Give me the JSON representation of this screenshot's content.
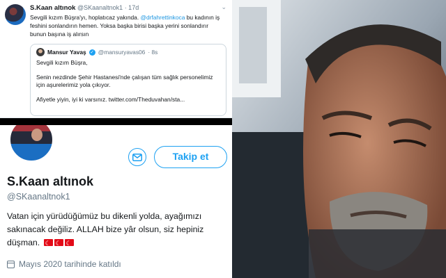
{
  "tweet": {
    "name": "S.Kaan altınok",
    "handle": "@SKaanaltnok1",
    "time": "· 17d",
    "text_part1": "Sevgili kızım Büşra'yı, hoplatıcaz yakında. ",
    "mention": "@drfahrettinkoca",
    "text_part2": " bu kadının iş feshini sonlandırın hemen. Yoksa başka birisi başka yerini sonlandırır bunun başına iş alırsın"
  },
  "quote": {
    "name": "Mansur Yavaş",
    "handle": "@mansuryavas06",
    "time": "· 8s",
    "line1": "Sevgili kızım Büşra,",
    "line2": "Senin nezdinde Şehir Hastanesi'nde çalışan tüm sağlık personelimiz için aşurelerimiz yola çıkıyor.",
    "line3": "Afiyetle yiyin, iyi ki varsınız. twitter.com/Theduvahan/sta..."
  },
  "profile": {
    "follow_label": "Takip et",
    "name": "S.Kaan altınok",
    "handle": "@SKaanaltnok1",
    "bio": "Vatan için yürüdüğümüz bu dikenli yolda, ayağımızı sakınacak değiliz. ALLAH bize yâr olsun, siz hepiniz düşman.",
    "joined": "Mayıs 2020 tarihinde katıldı"
  },
  "colors": {
    "accent": "#1da1f2",
    "text": "#14171a",
    "muted": "#657786",
    "flag": "#e30a17"
  },
  "icons": [
    "caret-down-icon",
    "verified-icon",
    "message-icon",
    "calendar-icon",
    "turkish-flag-icon"
  ]
}
